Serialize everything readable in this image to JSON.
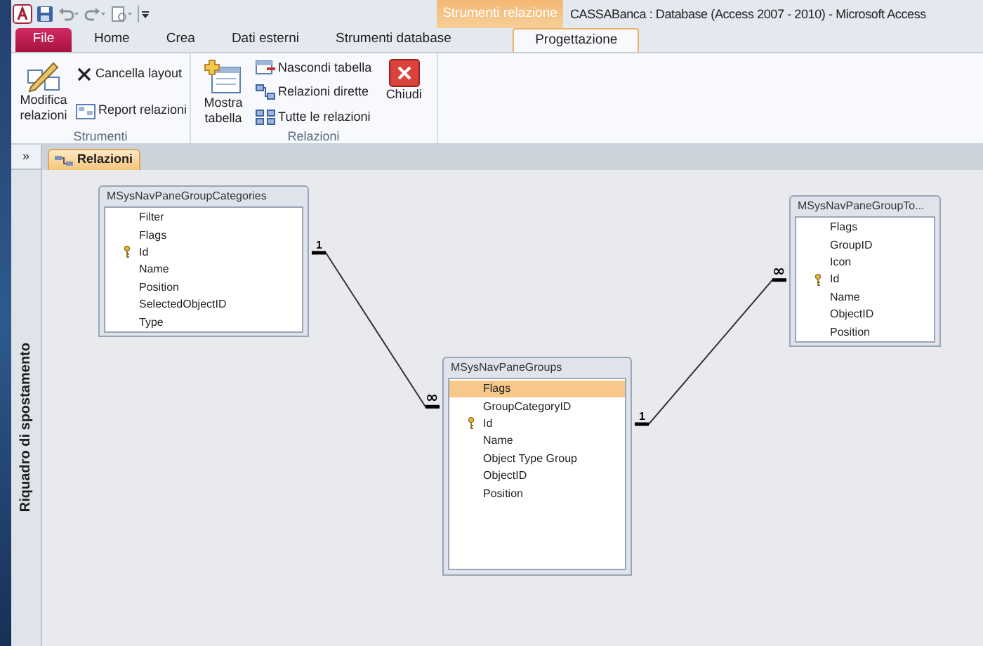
{
  "window": {
    "title": "CASSABanca : Database (Access 2007 - 2010)  -  Microsoft Access",
    "context_tab_group": "Strumenti relazione"
  },
  "tabs": [
    {
      "label": "File",
      "kind": "file",
      "selected": false
    },
    {
      "label": "Home",
      "kind": "tab",
      "selected": false
    },
    {
      "label": "Crea",
      "kind": "tab",
      "selected": false
    },
    {
      "label": "Dati esterni",
      "kind": "tab",
      "selected": false
    },
    {
      "label": "Strumenti database",
      "kind": "tab",
      "selected": false
    },
    {
      "label": "Progettazione",
      "kind": "context",
      "selected": true
    }
  ],
  "ribbon_groups": [
    {
      "label": "Strumenti",
      "buttons": [
        {
          "label": "Modifica relazioni",
          "kind": "large"
        },
        {
          "label": "Cancella layout",
          "kind": "small"
        },
        {
          "label": "Report relazioni",
          "kind": "small"
        }
      ]
    },
    {
      "label": "Relazioni",
      "buttons": [
        {
          "label": "Mostra tabella",
          "kind": "large"
        },
        {
          "label": "Nascondi tabella",
          "kind": "small"
        },
        {
          "label": "Relazioni dirette",
          "kind": "small"
        },
        {
          "label": "Tutte le relazioni",
          "kind": "small"
        },
        {
          "label": "Chiudi",
          "kind": "large"
        }
      ]
    }
  ],
  "nav_pane": {
    "toggle": "»",
    "title": "Riquadro di spostamento"
  },
  "document_tab": {
    "label": "Relazioni",
    "selected": true
  },
  "tables": [
    {
      "name": "MSysNavPaneGroupCategories",
      "fields": [
        {
          "name": "Filter",
          "key": false,
          "selected": false
        },
        {
          "name": "Flags",
          "key": false,
          "selected": false
        },
        {
          "name": "Id",
          "key": true,
          "selected": false
        },
        {
          "name": "Name",
          "key": false,
          "selected": false
        },
        {
          "name": "Position",
          "key": false,
          "selected": false
        },
        {
          "name": "SelectedObjectID",
          "key": false,
          "selected": false
        },
        {
          "name": "Type",
          "key": false,
          "selected": false
        }
      ]
    },
    {
      "name": "MSysNavPaneGroups",
      "fields": [
        {
          "name": "Flags",
          "key": false,
          "selected": true
        },
        {
          "name": "GroupCategoryID",
          "key": false,
          "selected": false
        },
        {
          "name": "Id",
          "key": true,
          "selected": false
        },
        {
          "name": "Name",
          "key": false,
          "selected": false
        },
        {
          "name": "Object Type Group",
          "key": false,
          "selected": false
        },
        {
          "name": "ObjectID",
          "key": false,
          "selected": false
        },
        {
          "name": "Position",
          "key": false,
          "selected": false
        }
      ]
    },
    {
      "name": "MSysNavPaneGroupTo...",
      "fields": [
        {
          "name": "Flags",
          "key": false,
          "selected": false
        },
        {
          "name": "GroupID",
          "key": false,
          "selected": false
        },
        {
          "name": "Icon",
          "key": false,
          "selected": false
        },
        {
          "name": "Id",
          "key": true,
          "selected": false
        },
        {
          "name": "Name",
          "key": false,
          "selected": false
        },
        {
          "name": "ObjectID",
          "key": false,
          "selected": false
        },
        {
          "name": "Position",
          "key": false,
          "selected": false
        }
      ]
    }
  ],
  "relationships": [
    {
      "one_label": "1",
      "many_label": "∞"
    },
    {
      "one_label": "1",
      "many_label": "∞"
    }
  ]
}
